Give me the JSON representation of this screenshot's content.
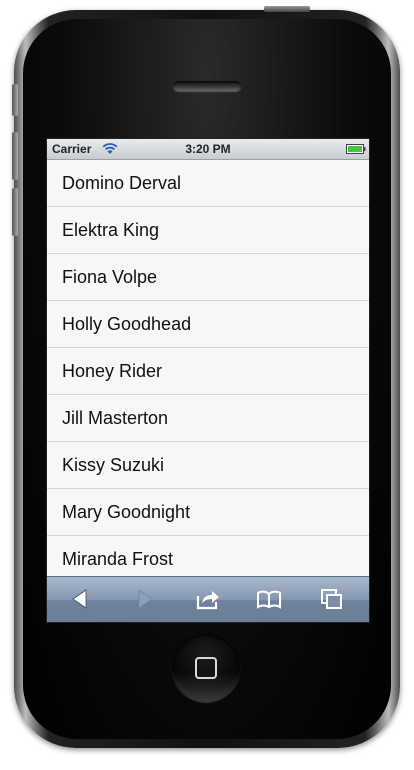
{
  "status_bar": {
    "carrier": "Carrier",
    "time": "3:20 PM",
    "wifi_icon": "wifi-icon",
    "battery_icon": "battery-full-icon",
    "battery_color": "#3ec93e"
  },
  "list": {
    "items": [
      {
        "label": "Domino Derval"
      },
      {
        "label": "Elektra King"
      },
      {
        "label": "Fiona Volpe"
      },
      {
        "label": "Holly Goodhead"
      },
      {
        "label": "Honey Rider"
      },
      {
        "label": "Jill Masterton"
      },
      {
        "label": "Kissy Suzuki"
      },
      {
        "label": "Mary Goodnight"
      },
      {
        "label": "Miranda Frost"
      }
    ]
  },
  "toolbar": {
    "buttons": [
      {
        "icon": "back-arrow-icon",
        "enabled": true
      },
      {
        "icon": "forward-arrow-icon",
        "enabled": false
      },
      {
        "icon": "share-icon",
        "enabled": true
      },
      {
        "icon": "bookmarks-icon",
        "enabled": true
      },
      {
        "icon": "pages-icon",
        "enabled": true
      }
    ],
    "color": "#7b8fa9"
  },
  "device": {
    "home_button_icon": "home-square-icon"
  }
}
